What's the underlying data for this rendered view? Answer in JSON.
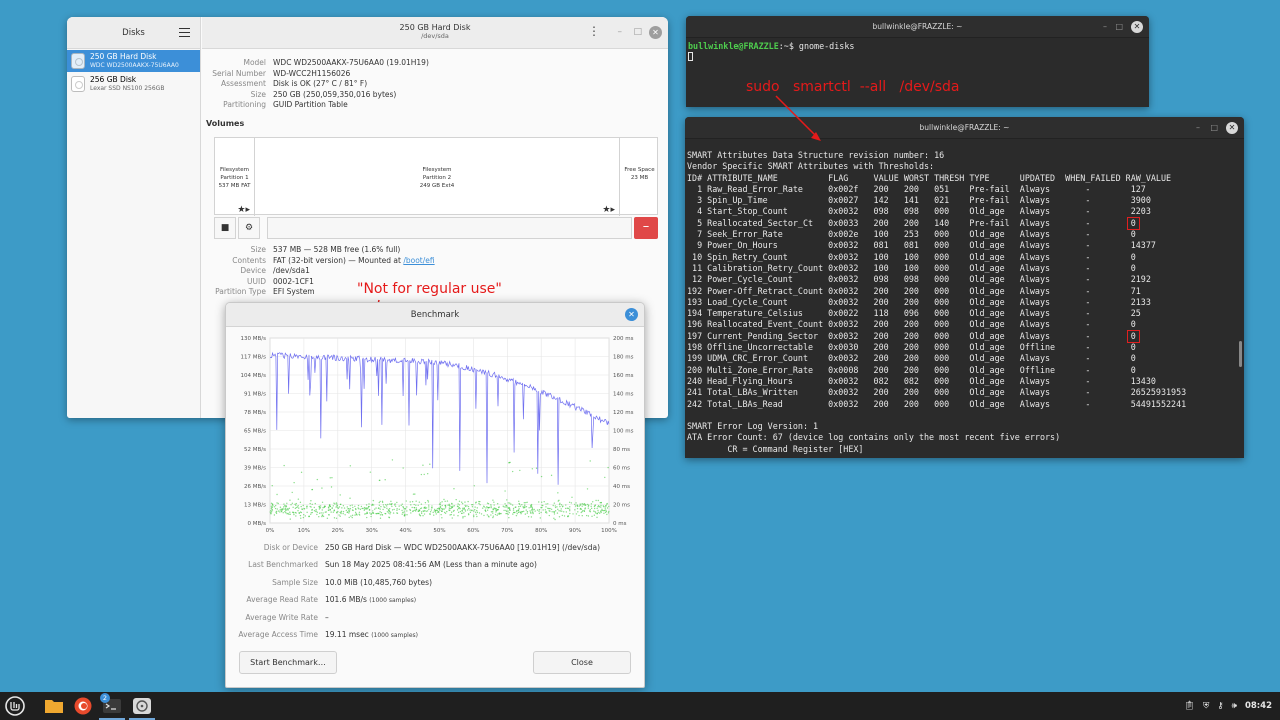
{
  "disks": {
    "sidebar_title": "Disks",
    "window_title": "250 GB Hard Disk",
    "window_subtitle": "/dev/sda",
    "devices": [
      {
        "name": "250 GB Hard Disk",
        "model": "WDC WD2500AAKX-75U6AA0"
      },
      {
        "name": "256 GB Disk",
        "model": "Lexar SSD NS100 256GB"
      }
    ],
    "info": [
      {
        "key": "Model",
        "value": "WDC WD2500AAKX-75U6AA0 (19.01H19)"
      },
      {
        "key": "Serial Number",
        "value": "WD-WCC2H1156026"
      },
      {
        "key": "Assessment",
        "value": "Disk is OK (27° C / 81° F)"
      },
      {
        "key": "Size",
        "value": "250 GB (250,059,350,016 bytes)"
      },
      {
        "key": "Partitioning",
        "value": "GUID Partition Table"
      }
    ],
    "volumes_label": "Volumes",
    "partitions": [
      {
        "line1": "Filesystem",
        "line2": "Partition 1",
        "line3": "537 MB FAT"
      },
      {
        "line1": "Filesystem",
        "line2": "Partition 2",
        "line3": "249 GB Ext4"
      },
      {
        "line1": "Free Space",
        "line2": "23 MB",
        "line3": ""
      }
    ],
    "part_info": [
      {
        "key": "Size",
        "value": "537 MB — 528 MB free (1.6% full)"
      },
      {
        "key": "Contents",
        "value": "FAT (32-bit version) — Mounted at ",
        "link": "/boot/efi"
      },
      {
        "key": "Device",
        "value": "/dev/sda1"
      },
      {
        "key": "UUID",
        "value": "0002-1CF1"
      },
      {
        "key": "Partition Type",
        "value": "EFI System"
      }
    ]
  },
  "benchmark": {
    "title": "Benchmark",
    "annotation": "\"Not for regular use\"",
    "left_axis": [
      "130 MB/s",
      "117 MB/s",
      "104 MB/s",
      "91 MB/s",
      "78 MB/s",
      "65 MB/s",
      "52 MB/s",
      "39 MB/s",
      "26 MB/s",
      "13 MB/s",
      "0 MB/s"
    ],
    "right_axis": [
      "200 ms",
      "180 ms",
      "160 ms",
      "140 ms",
      "120 ms",
      "100 ms",
      "80 ms",
      "60 ms",
      "40 ms",
      "20 ms",
      "0 ms"
    ],
    "x_axis": [
      "0%",
      "10%",
      "20%",
      "30%",
      "40%",
      "50%",
      "60%",
      "70%",
      "80%",
      "90%",
      "100%"
    ],
    "details": [
      {
        "key": "Disk or Device",
        "value": "250 GB Hard Disk — WDC WD2500AAKX-75U6AA0 [19.01H19] (/dev/sda)",
        "note": ""
      },
      {
        "key": "Last Benchmarked",
        "value": "Sun 18 May 2025 08:41:56 AM (Less than a minute ago)",
        "note": ""
      },
      {
        "key": "Sample Size",
        "value": "10.0 MiB (10,485,760 bytes)",
        "note": ""
      },
      {
        "key": "Average Read Rate",
        "value": "101.6 MB/s ",
        "note": "(1000 samples)"
      },
      {
        "key": "Average Write Rate",
        "value": "–",
        "note": ""
      },
      {
        "key": "Average Access Time",
        "value": "19.11 msec ",
        "note": "(1000 samples)"
      }
    ],
    "start_button": "Start Benchmark…",
    "close_button": "Close"
  },
  "term1": {
    "title": "bullwinkle@FRAZZLE: ~",
    "prompt": "bullwinkle@FRAZZLE",
    "command": ":~$ gnome-disks"
  },
  "annotation_cmd": "sudo   smartctl  --all   /dev/sda",
  "term2": {
    "title": "bullwinkle@FRAZZLE: ~",
    "header_lines": [
      "SMART Attributes Data Structure revision number: 16",
      "Vendor Specific SMART Attributes with Thresholds:",
      "ID# ATTRIBUTE_NAME          FLAG     VALUE WORST THRESH TYPE      UPDATED  WHEN_FAILED RAW_VALUE"
    ],
    "rows": [
      [
        "  1",
        "Raw_Read_Error_Rate    ",
        "0x002f",
        "200",
        "200",
        "051",
        "Pre-fail",
        "Always",
        "127"
      ],
      [
        "  3",
        "Spin_Up_Time           ",
        "0x0027",
        "142",
        "141",
        "021",
        "Pre-fail",
        "Always",
        "3900"
      ],
      [
        "  4",
        "Start_Stop_Count       ",
        "0x0032",
        "098",
        "098",
        "000",
        "Old_age ",
        "Always",
        "2203"
      ],
      [
        "  5",
        "Reallocated_Sector_Ct  ",
        "0x0033",
        "200",
        "200",
        "140",
        "Pre-fail",
        "Always",
        "0"
      ],
      [
        "  7",
        "Seek_Error_Rate        ",
        "0x002e",
        "100",
        "253",
        "000",
        "Old_age ",
        "Always",
        "0"
      ],
      [
        "  9",
        "Power_On_Hours         ",
        "0x0032",
        "081",
        "081",
        "000",
        "Old_age ",
        "Always",
        "14377"
      ],
      [
        " 10",
        "Spin_Retry_Count       ",
        "0x0032",
        "100",
        "100",
        "000",
        "Old_age ",
        "Always",
        "0"
      ],
      [
        " 11",
        "Calibration_Retry_Count",
        "0x0032",
        "100",
        "100",
        "000",
        "Old_age ",
        "Always",
        "0"
      ],
      [
        " 12",
        "Power_Cycle_Count      ",
        "0x0032",
        "098",
        "098",
        "000",
        "Old_age ",
        "Always",
        "2192"
      ],
      [
        "192",
        "Power-Off_Retract_Count",
        "0x0032",
        "200",
        "200",
        "000",
        "Old_age ",
        "Always",
        "71"
      ],
      [
        "193",
        "Load_Cycle_Count       ",
        "0x0032",
        "200",
        "200",
        "000",
        "Old_age ",
        "Always",
        "2133"
      ],
      [
        "194",
        "Temperature_Celsius    ",
        "0x0022",
        "118",
        "096",
        "000",
        "Old_age ",
        "Always",
        "25"
      ],
      [
        "196",
        "Reallocated_Event_Count",
        "0x0032",
        "200",
        "200",
        "000",
        "Old_age ",
        "Always",
        "0"
      ],
      [
        "197",
        "Current_Pending_Sector ",
        "0x0032",
        "200",
        "200",
        "000",
        "Old_age ",
        "Always",
        "0"
      ],
      [
        "198",
        "Offline_Uncorrectable  ",
        "0x0030",
        "200",
        "200",
        "000",
        "Old_age ",
        "Offline",
        "0"
      ],
      [
        "199",
        "UDMA_CRC_Error_Count   ",
        "0x0032",
        "200",
        "200",
        "000",
        "Old_age ",
        "Always",
        "0"
      ],
      [
        "200",
        "Multi_Zone_Error_Rate  ",
        "0x0008",
        "200",
        "200",
        "000",
        "Old_age ",
        "Offline",
        "0"
      ],
      [
        "240",
        "Head_Flying_Hours      ",
        "0x0032",
        "082",
        "082",
        "000",
        "Old_age ",
        "Always",
        "13430"
      ],
      [
        "241",
        "Total_LBAs_Written     ",
        "0x0032",
        "200",
        "200",
        "000",
        "Old_age ",
        "Always",
        "26525931953"
      ],
      [
        "242",
        "Total_LBAs_Read        ",
        "0x0032",
        "200",
        "200",
        "000",
        "Old_age ",
        "Always",
        "54491552241"
      ]
    ],
    "highlighted_rows": [
      3,
      13
    ],
    "footer_lines": [
      "",
      "SMART Error Log Version: 1",
      "ATA Error Count: 67 (device log contains only the most recent five errors)",
      "        CR = Command Register [HEX]"
    ]
  },
  "taskbar": {
    "badge": "2",
    "clock": "08:42"
  },
  "colors": {
    "accent": "#3c8fd8",
    "desktop": "#3d9bc7",
    "prompt": "#4ecd4e",
    "annotation": "#e51a1a",
    "read_line": "#6f6ff0",
    "access_dots": "#3cc83c"
  }
}
